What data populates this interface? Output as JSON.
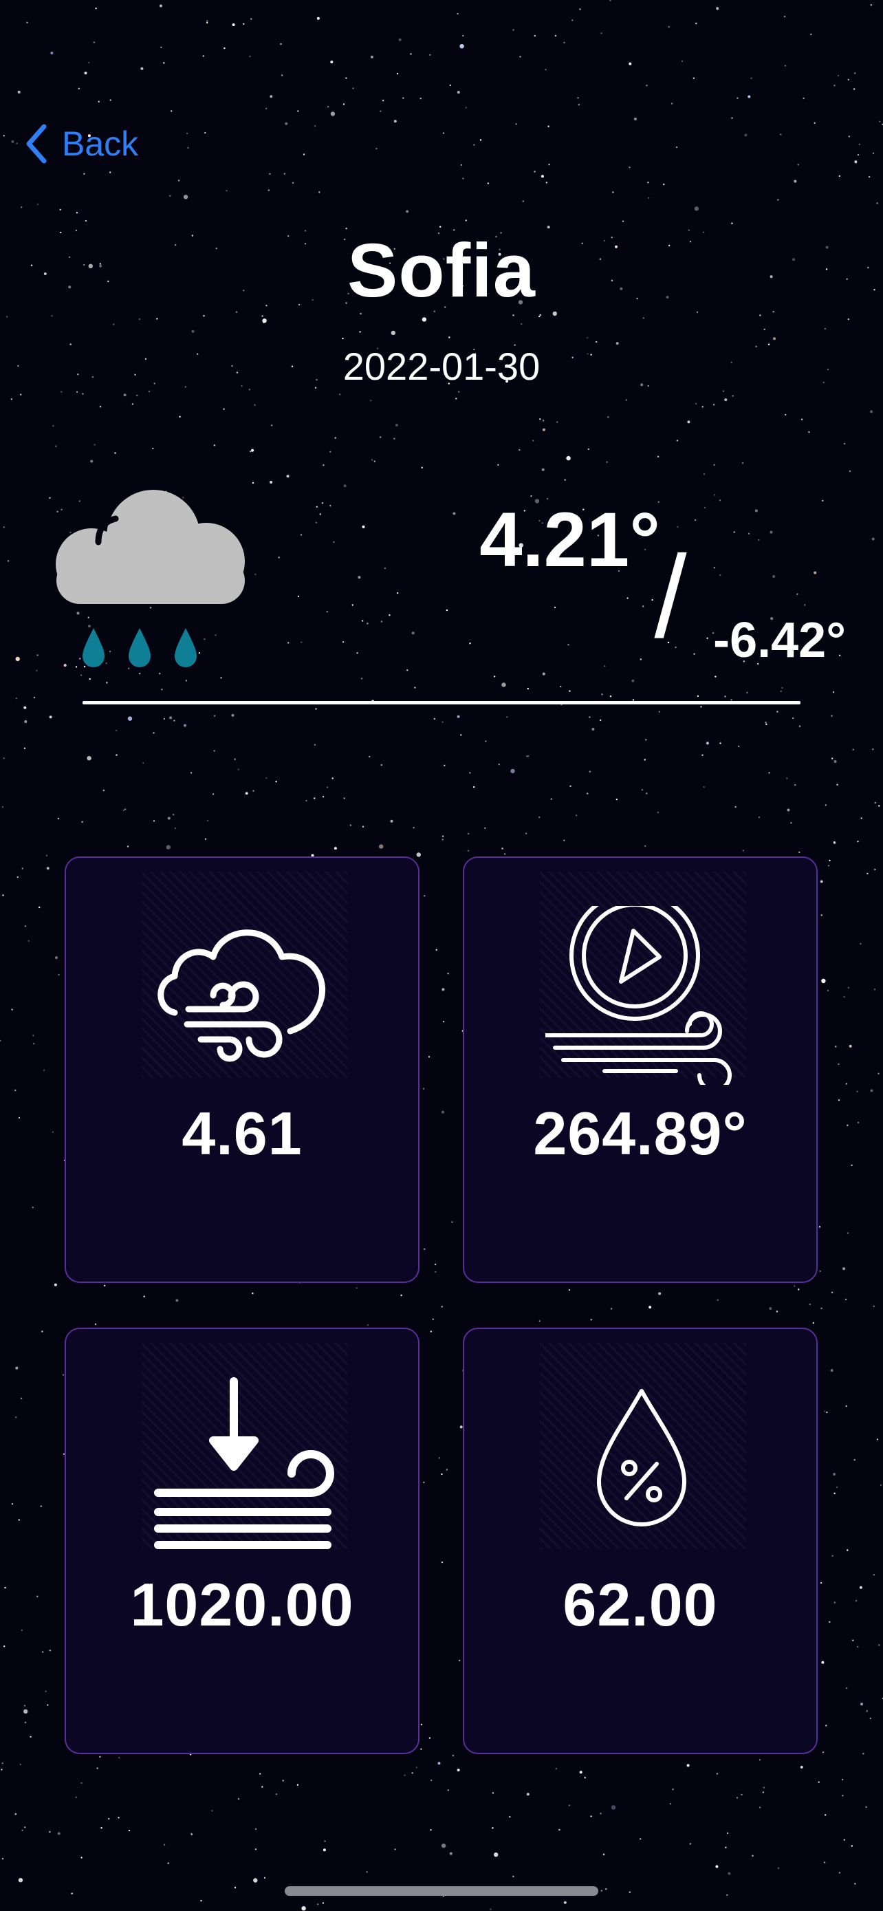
{
  "nav": {
    "back_label": "Back"
  },
  "location": {
    "city": "Sofia",
    "date": "2022-01-30"
  },
  "current": {
    "condition_icon": "rain-cloud-icon",
    "temp_max": "4.21°",
    "separator": "/",
    "temp_min": "-6.42°"
  },
  "metrics": [
    {
      "icon": "wind-cloud-icon",
      "value": "4.61"
    },
    {
      "icon": "wind-direction-compass-icon",
      "value": "264.89°"
    },
    {
      "icon": "pressure-icon",
      "value": "1020.00"
    },
    {
      "icon": "humidity-drop-icon",
      "value": "62.00"
    }
  ],
  "colors": {
    "background": "#040410",
    "accent": "#2f80f5",
    "tile_bg": "#0b0624",
    "tile_border": "#5a2e9a",
    "cloud": "#c0c0c0",
    "rain": "#0e7f95"
  }
}
